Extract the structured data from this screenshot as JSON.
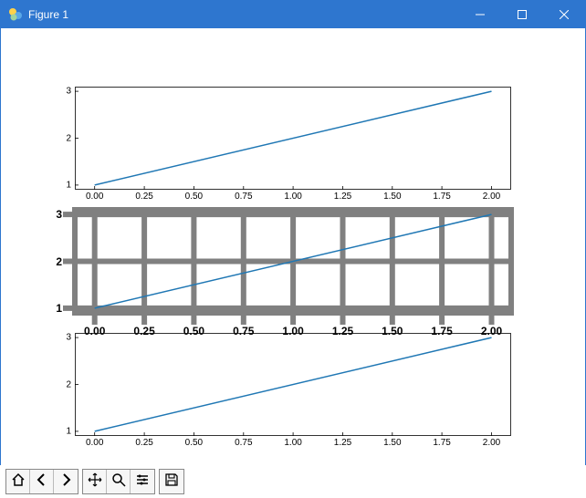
{
  "window": {
    "title": "Figure 1"
  },
  "colors": {
    "titlebar_bg": "#2e76cf",
    "line": "#1f77b4",
    "mid_spines": "#808080"
  },
  "toolbar": {
    "buttons": [
      {
        "name": "home-icon"
      },
      {
        "name": "back-icon"
      },
      {
        "name": "forward-icon"
      },
      {
        "name": "pan-icon"
      },
      {
        "name": "zoom-icon"
      },
      {
        "name": "configure-icon"
      },
      {
        "name": "save-icon"
      }
    ]
  },
  "chart_data": [
    {
      "type": "line",
      "x": [
        0.0,
        2.0
      ],
      "y": [
        1.0,
        3.0
      ],
      "xticks": [
        "0.00",
        "0.25",
        "0.50",
        "0.75",
        "1.00",
        "1.25",
        "1.50",
        "1.75",
        "2.00"
      ],
      "yticks": [
        "1",
        "2",
        "3"
      ],
      "xlim": [
        -0.1,
        2.1
      ],
      "ylim": [
        0.9,
        3.1
      ],
      "grid": false,
      "style": "normal"
    },
    {
      "type": "line",
      "x": [
        0.0,
        2.0
      ],
      "y": [
        1.0,
        3.0
      ],
      "xticks": [
        "0.00",
        "0.25",
        "0.50",
        "0.75",
        "1.00",
        "1.25",
        "1.50",
        "1.75",
        "2.00"
      ],
      "yticks": [
        "1",
        "2",
        "3"
      ],
      "xlim": [
        -0.1,
        2.1
      ],
      "ylim": [
        0.9,
        3.1
      ],
      "grid": true,
      "style": "bold_gray"
    },
    {
      "type": "line",
      "x": [
        0.0,
        2.0
      ],
      "y": [
        1.0,
        3.0
      ],
      "xticks": [
        "0.00",
        "0.25",
        "0.50",
        "0.75",
        "1.00",
        "1.25",
        "1.50",
        "1.75",
        "2.00"
      ],
      "yticks": [
        "1",
        "2",
        "3"
      ],
      "xlim": [
        -0.1,
        2.1
      ],
      "ylim": [
        0.9,
        3.1
      ],
      "grid": false,
      "style": "normal"
    }
  ]
}
